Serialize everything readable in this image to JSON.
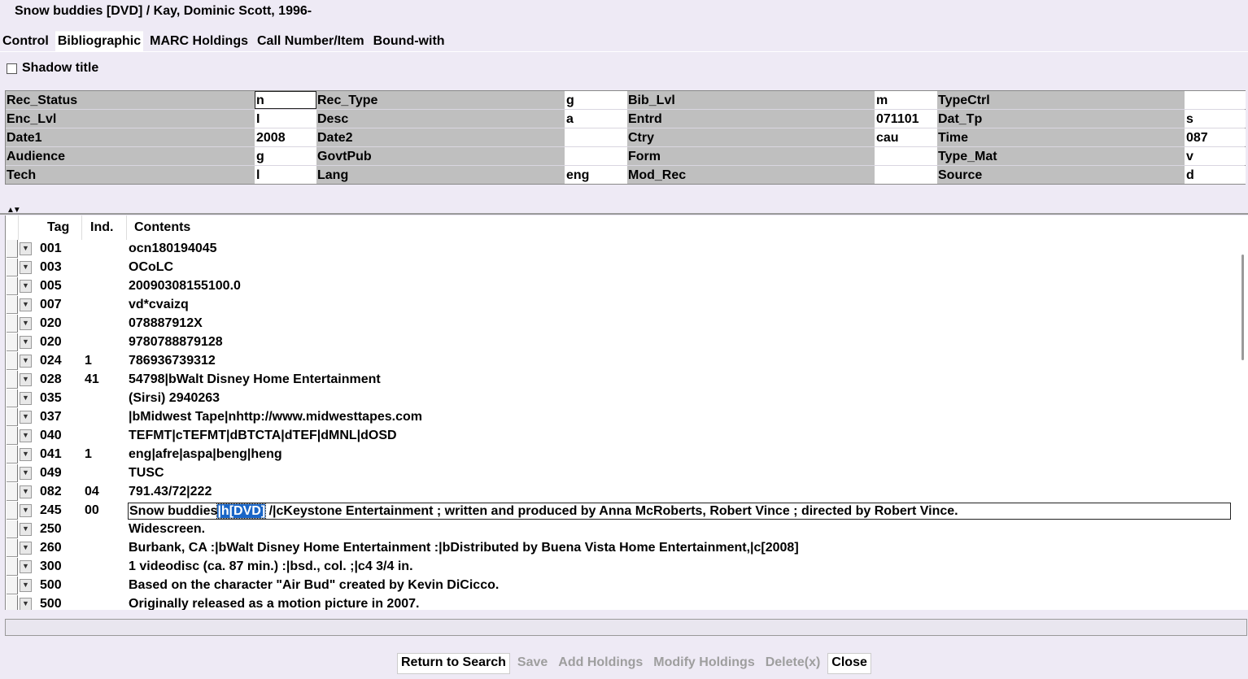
{
  "window": {
    "title": "Snow buddies [DVD] / Kay, Dominic Scott, 1996-"
  },
  "tabs": [
    {
      "label": "Control",
      "active": false
    },
    {
      "label": "Bibliographic",
      "active": true
    },
    {
      "label": "MARC Holdings",
      "active": false
    },
    {
      "label": "Call Number/Item",
      "active": false
    },
    {
      "label": "Bound-with",
      "active": false
    }
  ],
  "shadow_title": {
    "label": "Shadow title",
    "checked": false
  },
  "fixed_fields": [
    [
      {
        "label": "Rec_Status",
        "value": "n"
      },
      {
        "label": "Rec_Type",
        "value": "g"
      },
      {
        "label": "Bib_Lvl",
        "value": "m"
      },
      {
        "label": "TypeCtrl",
        "value": ""
      }
    ],
    [
      {
        "label": "Enc_Lvl",
        "value": "I"
      },
      {
        "label": "Desc",
        "value": "a"
      },
      {
        "label": "Entrd",
        "value": "071101"
      },
      {
        "label": "Dat_Tp",
        "value": "s"
      }
    ],
    [
      {
        "label": "Date1",
        "value": "2008"
      },
      {
        "label": "Date2",
        "value": ""
      },
      {
        "label": "Ctry",
        "value": "cau"
      },
      {
        "label": "Time",
        "value": "087"
      }
    ],
    [
      {
        "label": "Audience",
        "value": "g"
      },
      {
        "label": "GovtPub",
        "value": ""
      },
      {
        "label": "Form",
        "value": ""
      },
      {
        "label": "Type_Mat",
        "value": "v"
      }
    ],
    [
      {
        "label": "Tech",
        "value": "l"
      },
      {
        "label": "Lang",
        "value": "eng"
      },
      {
        "label": "Mod_Rec",
        "value": ""
      },
      {
        "label": "Source",
        "value": "d"
      }
    ]
  ],
  "marc": {
    "headers": {
      "tag": "Tag",
      "ind": "Ind.",
      "contents": "Contents"
    },
    "rows": [
      {
        "tag": "001",
        "ind": "",
        "contents": "ocn180194045"
      },
      {
        "tag": "003",
        "ind": "",
        "contents": "OCoLC"
      },
      {
        "tag": "005",
        "ind": "",
        "contents": "20090308155100.0"
      },
      {
        "tag": "007",
        "ind": "",
        "contents": "vd*cvaizq"
      },
      {
        "tag": "020",
        "ind": "",
        "contents": "078887912X"
      },
      {
        "tag": "020",
        "ind": "",
        "contents": "9780788879128"
      },
      {
        "tag": "024",
        "ind": "1",
        "contents": "786936739312"
      },
      {
        "tag": "028",
        "ind": "41",
        "contents": "54798|bWalt Disney Home Entertainment"
      },
      {
        "tag": "035",
        "ind": "",
        "contents": "(Sirsi) 2940263"
      },
      {
        "tag": "037",
        "ind": "",
        "contents": "|bMidwest Tape|nhttp://www.midwesttapes.com"
      },
      {
        "tag": "040",
        "ind": "",
        "contents": "TEFMT|cTEFMT|dBTCTA|dTEF|dMNL|dOSD"
      },
      {
        "tag": "041",
        "ind": "1",
        "contents": "eng|afre|aspa|beng|heng"
      },
      {
        "tag": "049",
        "ind": "",
        "contents": "TUSC"
      },
      {
        "tag": "082",
        "ind": "04",
        "contents": "791.43/72|222"
      },
      {
        "tag": "245",
        "ind": "00",
        "contents": "",
        "pre": "Snow buddies",
        "sel": "|h[DVD]",
        "post": " /|cKeystone Entertainment ; written and produced by Anna McRoberts, Robert Vince ; directed by Robert Vince."
      },
      {
        "tag": "250",
        "ind": "",
        "contents": "Widescreen."
      },
      {
        "tag": "260",
        "ind": "",
        "contents": "Burbank, CA :|bWalt Disney Home Entertainment :|bDistributed by Buena Vista Home Entertainment,|c[2008]"
      },
      {
        "tag": "300",
        "ind": "",
        "contents": "1 videodisc (ca. 87 min.) :|bsd., col. ;|c4 3/4 in."
      },
      {
        "tag": "500",
        "ind": "",
        "contents": "Based on the character \"Air Bud\" created by Kevin DiCicco."
      },
      {
        "tag": "500",
        "ind": "",
        "contents": "Originally released as a motion picture in 2007."
      }
    ]
  },
  "buttons": [
    {
      "label": "Return to Search",
      "enabled": true
    },
    {
      "label": "Save",
      "enabled": false
    },
    {
      "label": "Add Holdings",
      "enabled": false
    },
    {
      "label": "Modify Holdings",
      "enabled": false
    },
    {
      "label": "Delete(x)",
      "enabled": false
    },
    {
      "label": "Close",
      "enabled": true
    }
  ],
  "icons": {
    "row_dropdown": "chevron-down-icon",
    "splitter": "split-arrows-icon"
  }
}
